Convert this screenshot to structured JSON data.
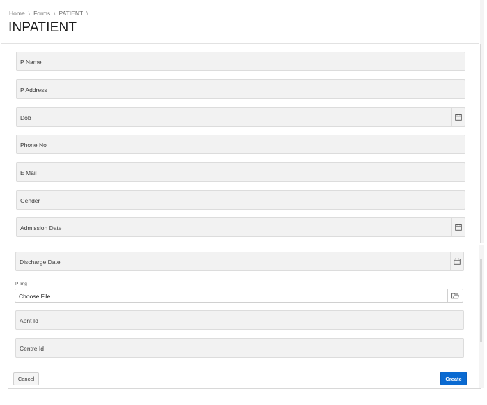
{
  "breadcrumb": [
    "Home",
    "Forms",
    "PATIENT"
  ],
  "page_title": "INPATIENT",
  "fields": [
    {
      "label": "P Name"
    },
    {
      "label": "P Address"
    },
    {
      "label": "Dob"
    },
    {
      "label": "Phone No"
    },
    {
      "label": "E Mail"
    },
    {
      "label": "Gender"
    },
    {
      "label": "Admission Date"
    },
    {
      "label": "Discharge Date"
    },
    {
      "label": "Apnt Id"
    },
    {
      "label": "Centre Id"
    }
  ],
  "file_upload": {
    "label": "P Img",
    "value": "Choose File"
  },
  "buttons": {
    "cancel": "Cancel",
    "create": "Create"
  },
  "icons": {
    "date_picker": "calendar-icon",
    "file_picker": "folder-open-icon"
  },
  "colors": {
    "primary": "#0a6ad1",
    "field_bg": "#f2f2f2"
  }
}
